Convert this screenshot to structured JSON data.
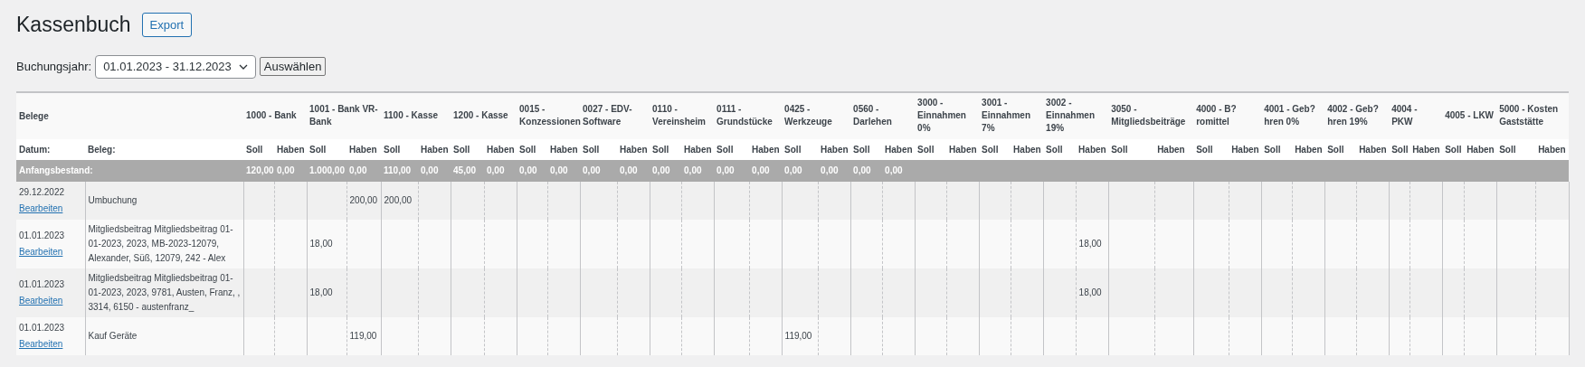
{
  "page": {
    "title": "Kassenbuch",
    "export_button": "Export"
  },
  "filter": {
    "label": "Buchungsjahr:",
    "select_value": "01.01.2023 - 31.12.2023",
    "submit_button": "Auswählen"
  },
  "table": {
    "group_header": "Belege",
    "date_header": "Datum:",
    "beleg_header": "Beleg:",
    "opening_label": "Anfangsbestand:",
    "accounts": [
      {
        "name": "1000 - Bank",
        "soll_label": "Soll",
        "haben_label": "Haben",
        "opening": {
          "soll": "120,00",
          "haben": "0,00"
        }
      },
      {
        "name": "1001 - Bank VR-Bank",
        "soll_label": "Soll",
        "haben_label": "Haben",
        "opening": {
          "soll": "1.000,00",
          "haben": "0,00"
        }
      },
      {
        "name": "1100 - Kasse",
        "soll_label": "Soll",
        "haben_label": "Haben",
        "opening": {
          "soll": "110,00",
          "haben": "0,00"
        }
      },
      {
        "name": "1200 - Kasse",
        "soll_label": "Soll",
        "haben_label": "Haben",
        "opening": {
          "soll": "45,00",
          "haben": "0,00"
        }
      },
      {
        "name": "0015 - Konzessionen",
        "soll_label": "Soll",
        "haben_label": "Haben",
        "opening": {
          "soll": "0,00",
          "haben": "0,00"
        }
      },
      {
        "name": "0027 - EDV-Software",
        "soll_label": "Soll",
        "haben_label": "Haben",
        "opening": {
          "soll": "0,00",
          "haben": "0,00"
        }
      },
      {
        "name": "0110 - Vereinsheim",
        "soll_label": "Soll",
        "haben_label": "Haben",
        "opening": {
          "soll": "0,00",
          "haben": "0,00"
        }
      },
      {
        "name": "0111 - Grundstücke",
        "soll_label": "Soll",
        "haben_label": "Haben",
        "opening": {
          "soll": "0,00",
          "haben": "0,00"
        }
      },
      {
        "name": "0425 - Werkzeuge",
        "soll_label": "Soll",
        "haben_label": "Haben",
        "opening": {
          "soll": "0,00",
          "haben": "0,00"
        }
      },
      {
        "name": "0560 - Darlehen",
        "soll_label": "Soll",
        "haben_label": "Haben",
        "opening": {
          "soll": "0,00",
          "haben": "0,00"
        }
      },
      {
        "name": "3000 - Einnahmen 0%",
        "soll_label": "Soll",
        "haben_label": "Haben"
      },
      {
        "name": "3001 - Einnahmen 7%",
        "soll_label": "Soll",
        "haben_label": "Haben"
      },
      {
        "name": "3002 - Einnahmen 19%",
        "soll_label": "Soll",
        "haben_label": "Haben"
      },
      {
        "name": "3050 - Mitgliedsbeiträge",
        "soll_label": "Soll",
        "haben_label": "Haben"
      },
      {
        "name": "4000 - B?romittel",
        "soll_label": "Soll",
        "haben_label": "Haben"
      },
      {
        "name": "4001 - Geb?hren 0%",
        "soll_label": "Soll",
        "haben_label": "Haben"
      },
      {
        "name": "4002 - Geb?hren 19%",
        "soll_label": "Soll",
        "haben_label": "Haben"
      },
      {
        "name": "4004 - PKW",
        "soll_label": "Soll",
        "haben_label": "Haben"
      },
      {
        "name": "4005 - LKW",
        "soll_label": "Soll",
        "haben_label": "Haben"
      },
      {
        "name": "5000 - Kosten Gaststätte",
        "soll_label": "Soll",
        "haben_label": "Haben"
      }
    ],
    "rows": [
      {
        "date": "29.12.2022",
        "edit_link": "Bearbeiten",
        "beleg": "Umbuchung",
        "cells": [
          {},
          {
            "haben": "200,00"
          },
          {
            "soll": "200,00"
          },
          {},
          {},
          {},
          {},
          {},
          {},
          {},
          {},
          {},
          {},
          {},
          {},
          {},
          {},
          {},
          {},
          {}
        ]
      },
      {
        "date": "01.01.2023",
        "edit_link": "Bearbeiten",
        "beleg": "Mitgliedsbeitrag Mitgliedsbeitrag 01-01-2023, 2023, MB-2023-12079, Alexander, Süß, 12079, 242 - Alex",
        "cells": [
          {},
          {
            "soll": "18,00"
          },
          {},
          {},
          {},
          {},
          {},
          {},
          {},
          {},
          {},
          {},
          {
            "haben": "18,00"
          },
          {},
          {},
          {},
          {},
          {},
          {},
          {}
        ]
      },
      {
        "date": "01.01.2023",
        "edit_link": "Bearbeiten",
        "beleg": "Mitgliedsbeitrag Mitgliedsbeitrag 01-01-2023, 2023, 9781, Austen, Franz, , 3314, 6150 - austenfranz_",
        "cells": [
          {},
          {
            "soll": "18,00"
          },
          {},
          {},
          {},
          {},
          {},
          {},
          {},
          {},
          {},
          {},
          {
            "haben": "18,00"
          },
          {},
          {},
          {},
          {},
          {},
          {},
          {}
        ]
      },
      {
        "date": "01.01.2023",
        "edit_link": "Bearbeiten",
        "beleg": "Kauf Geräte",
        "cells": [
          {},
          {
            "haben": "119,00"
          },
          {},
          {},
          {},
          {},
          {},
          {},
          {
            "soll": "119,00"
          },
          {},
          {},
          {},
          {},
          {},
          {},
          {},
          {},
          {},
          {},
          {}
        ]
      }
    ]
  }
}
